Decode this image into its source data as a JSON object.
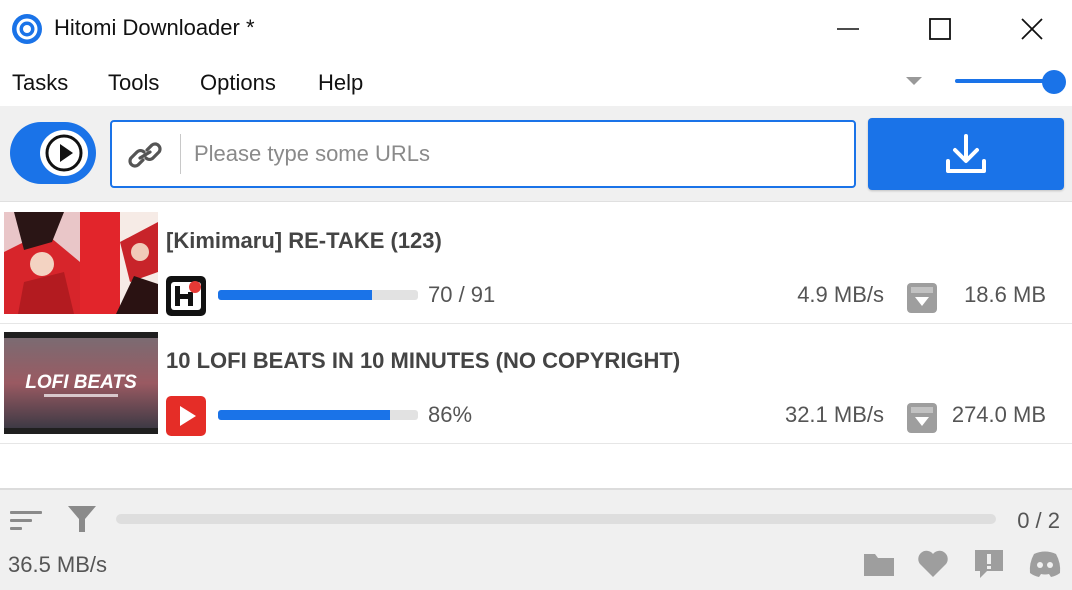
{
  "window": {
    "title": "Hitomi Downloader *",
    "accent_color": "#1a73e8"
  },
  "menu": {
    "items": [
      "Tasks",
      "Tools",
      "Options",
      "Help"
    ]
  },
  "toolbar": {
    "url_placeholder": "Please type some URLs",
    "play_icon": "play-icon",
    "link_icon": "link-icon",
    "download_icon": "download-icon"
  },
  "tasks": [
    {
      "title": "[Kimimaru] RE-TAKE (123)",
      "site_icon": "hitomi-icon",
      "progress": 0.769,
      "progress_text": "70 / 91",
      "speed": "4.9 MB/s",
      "size": "18.6 MB"
    },
    {
      "title": "10 LOFI BEATS IN 10 MINUTES (NO COPYRIGHT)",
      "site_icon": "youtube-icon",
      "progress": 0.86,
      "progress_text": "86%",
      "speed": "32.1 MB/s",
      "size": "274.0 MB",
      "thumbnail_text": "LOFI BEATS"
    }
  ],
  "footer": {
    "count": "0 / 2",
    "total_speed": "36.5 MB/s",
    "icons": [
      "folder-icon",
      "heart-icon",
      "feedback-icon",
      "discord-icon"
    ]
  }
}
